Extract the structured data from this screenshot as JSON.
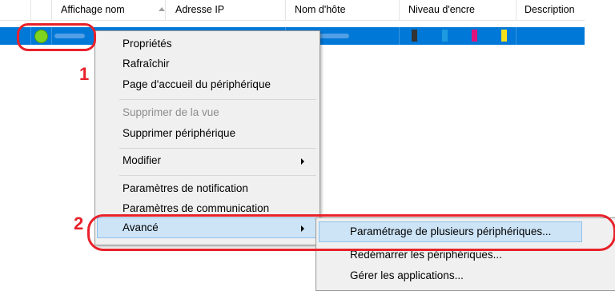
{
  "table": {
    "columns": [
      "Affichage nom",
      "Adresse IP",
      "Nom d'hôte",
      "Niveau d'encre",
      "Description"
    ],
    "ink_colors": [
      "#333333",
      "#1e9ae0",
      "#e0147c",
      "#f5e11a"
    ]
  },
  "status_color": "#7fd321",
  "context_menu": {
    "items": [
      "Propriétés",
      "Rafraîchir",
      "Page d'accueil du périphérique",
      "Supprimer de la vue",
      "Supprimer périphérique",
      "Modifier",
      "Paramètres de notification",
      "Paramètres de communication",
      "Avancé"
    ]
  },
  "submenu": {
    "items": [
      "Paramétrage de plusieurs périphériques...",
      "Redémarrer les périphériques...",
      "Gérer les applications..."
    ]
  },
  "annotations": {
    "step1": "1",
    "step2": "2",
    "highlight_color": "#e8212a"
  }
}
